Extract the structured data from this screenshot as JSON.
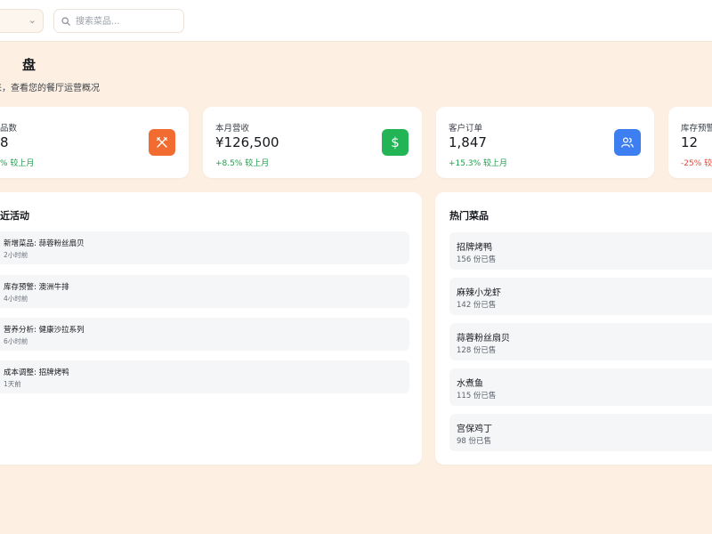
{
  "colors": {
    "page_bg": "#fdf0e2",
    "positive": "#1f9d4c",
    "negative": "#e5483b",
    "orange": "#f26b30",
    "green": "#22b455",
    "blue": "#3d7ef0"
  },
  "header": {
    "search_placeholder": "搜索菜品...",
    "search_icon": "search-icon",
    "select_icon": "chevron-down-icon"
  },
  "page": {
    "title": "盘",
    "subtitle": "来，查看您的餐厅运营概况"
  },
  "stats": [
    {
      "label": "品数",
      "value": "8",
      "change": "% 较上月",
      "trend": "up",
      "icon": "utensils-icon",
      "icon_color": "#f26b30"
    },
    {
      "label": "本月营收",
      "value": "¥126,500",
      "change": "+8.5% 较上月",
      "trend": "up",
      "icon": "dollar-icon",
      "icon_color": "#22b455"
    },
    {
      "label": "客户订单",
      "value": "1,847",
      "change": "+15.3% 较上月",
      "trend": "up",
      "icon": "users-icon",
      "icon_color": "#3d7ef0"
    },
    {
      "label": "库存预警",
      "value": "12",
      "change": "-25% 较",
      "trend": "down"
    }
  ],
  "activity": {
    "title": "近活动",
    "items": [
      {
        "text": "新增菜品: 蒜蓉粉丝扇贝",
        "time": "2小时前"
      },
      {
        "text": "库存预警: 澳洲牛排",
        "time": "4小时前"
      },
      {
        "text": "营养分析: 健康沙拉系列",
        "time": "6小时前"
      },
      {
        "text": "成本调整: 招牌烤鸭",
        "time": "1天前"
      }
    ]
  },
  "popular": {
    "title": "热门菜品",
    "items": [
      {
        "name": "招牌烤鸭",
        "count": "156 份已售"
      },
      {
        "name": "麻辣小龙虾",
        "count": "142 份已售"
      },
      {
        "name": "蒜蓉粉丝扇贝",
        "count": "128 份已售"
      },
      {
        "name": "水煮鱼",
        "count": "115 份已售"
      },
      {
        "name": "宫保鸡丁",
        "count": "98 份已售"
      }
    ]
  }
}
